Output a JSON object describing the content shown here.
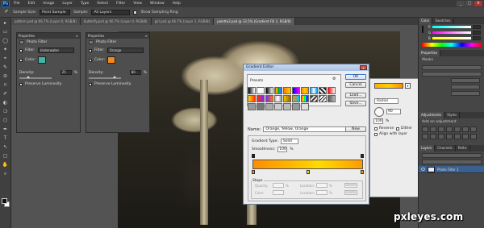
{
  "app": {
    "logo": "Ps",
    "menu": [
      "File",
      "Edit",
      "Image",
      "Layer",
      "Type",
      "Select",
      "Filter",
      "View",
      "Window",
      "Help"
    ],
    "window_buttons": [
      "_",
      "□",
      "×"
    ]
  },
  "options_bar": {
    "sample_size_label": "Sample Size:",
    "sample_size_value": "Point Sample",
    "sample_label": "Sample:",
    "sample_value": "All Layers",
    "show_ring_label": "Show Sampling Ring"
  },
  "tabs": [
    "pattern.psd @ 66.7% (Layer 0, RGB/8)",
    "butterfly.psd @ 66.7% (Layer 0, RGB/8)",
    "girl.psd @ 66.7% (Layer 1, RGB/8)",
    "palette2.psd @ 33.5% (Gradient Fill 1, RGB/8)"
  ],
  "tools": [
    "▸",
    "▭",
    "◯",
    "✦",
    "⌖",
    "✎",
    "⊘",
    "⌑",
    "✐",
    "◐",
    "❍",
    "⬡",
    "✒",
    "T",
    "↖",
    "▢",
    "✋",
    "⌕"
  ],
  "properties_left": {
    "panel_title": "Properties",
    "filter_name": "Photo Filter",
    "filter_label": "Filter:",
    "filter_value": "Underwater",
    "color_label": "Color:",
    "density_label": "Density:",
    "density_value": "25",
    "density_unit": "%",
    "preserve_label": "Preserve Luminosity",
    "swatch_color": "#3fb6a8"
  },
  "properties_right": {
    "panel_title": "Properties",
    "filter_name": "Photo Filter",
    "filter_label": "Filter:",
    "filter_value": "Orange",
    "color_label": "Color:",
    "density_label": "Density:",
    "density_value": "80",
    "density_unit": "%",
    "preserve_label": "Preserve Luminosity",
    "swatch_color": "#f08a1c"
  },
  "gradient_editor": {
    "title": "Gradient Editor",
    "close": "x",
    "presets_label": "Presets",
    "ok": "OK",
    "cancel": "Cancel",
    "load": "Load...",
    "save": "Save...",
    "name_label": "Name:",
    "name_value": "Orange, Yellow, Orange",
    "new": "New",
    "gradient_type_label": "Gradient Type:",
    "gradient_type_value": "Solid",
    "smoothness_label": "Smoothness:",
    "smoothness_value": "100",
    "smoothness_unit": "%",
    "stops_label": "Stops",
    "opacity_label": "Opacity:",
    "location_label": "Location:",
    "color_label": "Color:",
    "delete": "Delete",
    "pct": "%",
    "presets": [
      "#000000",
      "#ffffff",
      "#ff0000",
      "#ff7a00",
      "#0000ff",
      "#ff00ff",
      "#ffd200",
      "#00a0ff",
      "#ffffff",
      "#ff0000",
      "#ffe000",
      "#ff3000",
      "#7a2aff",
      "#c0c0c0",
      "#f0c000",
      "#ff9000",
      "#00c0ff",
      "#aaaaaa",
      "#ffffff",
      "#555555",
      "#999999",
      "#777777",
      "#aaaaaa",
      "#cccccc",
      "#bbbbbb",
      "#999999",
      "#dddddd"
    ]
  },
  "layer_style": {
    "style_value": "Radial",
    "angle_value": "90",
    "scale_value": "100",
    "scale_unit": "%",
    "reverse": "Reverse",
    "dither": "Dither",
    "align": "Align with layer",
    "ok": "OK",
    "cancel": "Cancel",
    "dropdown": "▾"
  },
  "right_panels": {
    "color_tab": "Color",
    "swatches_tab": "Swatches",
    "properties_tab": "Properties",
    "masks_label": "Masks",
    "adjustments_tab": "Adjustments",
    "styles_tab": "Styles",
    "adjust_hint": "Add an adjustment",
    "layers_tab": "Layers",
    "channels_tab": "Channels",
    "paths_tab": "Paths",
    "top_layer": "Photo Filter 1"
  },
  "watermark": "pxleyes.com"
}
